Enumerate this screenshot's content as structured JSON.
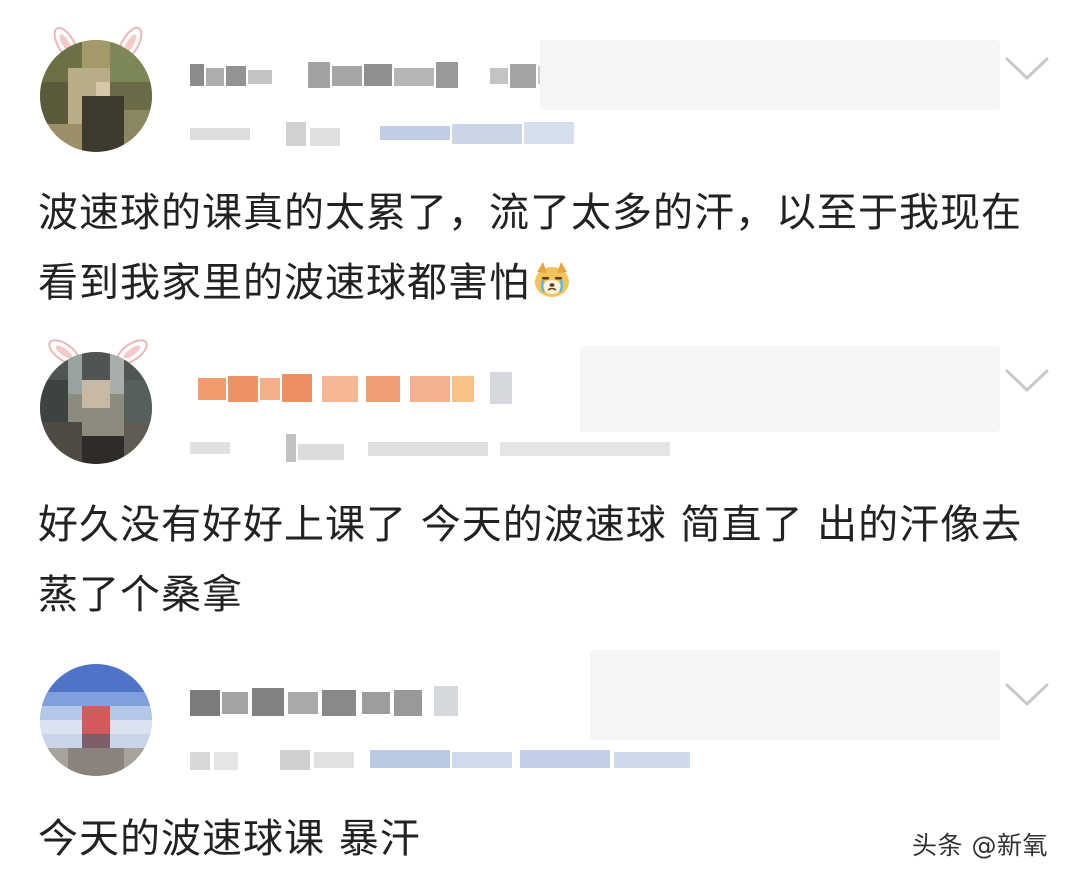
{
  "comments": [
    {
      "text": "波速球的课真的太累了，流了太多的汗，以至于我现在看到我家里的波速球都害怕"
    },
    {
      "text": "好久没有好好上课了 今天的波速球 简直了 出的汗像去蒸了个桑拿"
    },
    {
      "text": "今天的波速球课 暴汗"
    }
  ],
  "watermark": {
    "text": "头条 @新氧"
  },
  "icons": {
    "avatar_frame": "bunny-ears-icon",
    "expand": "chevron-down-icon",
    "emoji": "crying-dog-emoji-icon"
  },
  "colors": {
    "text": "#222222",
    "chevron": "#c8c8c8",
    "meta_grey": "#c7c7c7",
    "meta_blue": "#8ba6cf",
    "username_orange": "#f08a52"
  }
}
